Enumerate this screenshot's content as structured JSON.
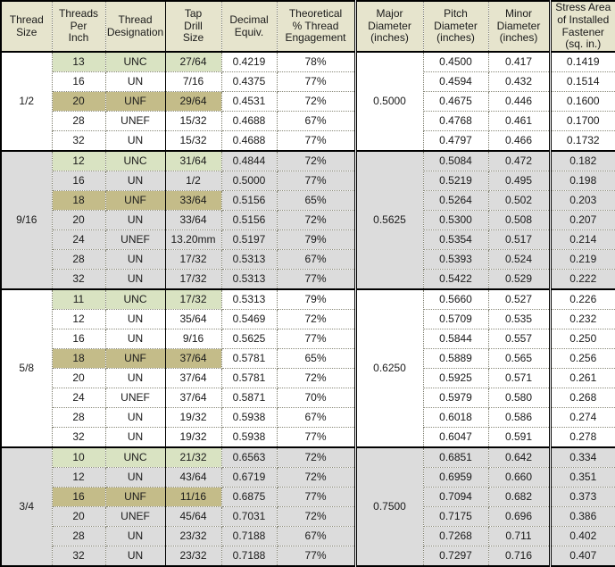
{
  "table": {
    "columns": [
      {
        "id": "thread_size",
        "lines": [
          "Thread",
          "Size"
        ],
        "bold": true
      },
      {
        "id": "threads_per_inch",
        "lines": [
          "Threads",
          "Per",
          "Inch"
        ],
        "bold": true
      },
      {
        "id": "thread_designation",
        "lines": [
          "Thread",
          "Designation"
        ],
        "bold": false
      },
      {
        "id": "tap_drill_size",
        "lines": [
          "Tap",
          "Drill",
          "Size"
        ],
        "bold": true
      },
      {
        "id": "decimal_equiv",
        "lines": [
          "Decimal",
          "Equiv."
        ],
        "bold": false
      },
      {
        "id": "pct_engagement",
        "lines": [
          "Theoretical",
          "% Thread",
          "Engagement"
        ],
        "bold": false
      },
      {
        "id": "major_diameter",
        "lines": [
          "Major",
          "Diameter",
          "(inches)"
        ],
        "bold": false
      },
      {
        "id": "pitch_diameter",
        "lines": [
          "Pitch",
          "Diameter",
          "(inches)"
        ],
        "bold": false
      },
      {
        "id": "minor_diameter",
        "lines": [
          "Minor",
          "Diameter",
          "(inches)"
        ],
        "bold": false
      },
      {
        "id": "stress_area",
        "lines": [
          "Stress Area",
          "of Installed",
          "Fastener",
          "(sq. in.)"
        ],
        "bold": false
      }
    ],
    "groups": [
      {
        "thread_size": "1/2",
        "major_diameter": "0.5000",
        "shaded": false,
        "rows": [
          {
            "tpi": "13",
            "designation": "UNC",
            "tap_drill": "27/64",
            "decimal": "0.4219",
            "engagement": "78%",
            "pitch": "0.4500",
            "minor": "0.417",
            "stress": "0.1419",
            "highlight": "unc"
          },
          {
            "tpi": "16",
            "designation": "UN",
            "tap_drill": "7/16",
            "decimal": "0.4375",
            "engagement": "77%",
            "pitch": "0.4594",
            "minor": "0.432",
            "stress": "0.1514",
            "highlight": ""
          },
          {
            "tpi": "20",
            "designation": "UNF",
            "tap_drill": "29/64",
            "decimal": "0.4531",
            "engagement": "72%",
            "pitch": "0.4675",
            "minor": "0.446",
            "stress": "0.1600",
            "highlight": "unf"
          },
          {
            "tpi": "28",
            "designation": "UNEF",
            "tap_drill": "15/32",
            "decimal": "0.4688",
            "engagement": "67%",
            "pitch": "0.4768",
            "minor": "0.461",
            "stress": "0.1700",
            "highlight": ""
          },
          {
            "tpi": "32",
            "designation": "UN",
            "tap_drill": "15/32",
            "decimal": "0.4688",
            "engagement": "77%",
            "pitch": "0.4797",
            "minor": "0.466",
            "stress": "0.1732",
            "highlight": ""
          }
        ]
      },
      {
        "thread_size": "9/16",
        "major_diameter": "0.5625",
        "shaded": true,
        "rows": [
          {
            "tpi": "12",
            "designation": "UNC",
            "tap_drill": "31/64",
            "decimal": "0.4844",
            "engagement": "72%",
            "pitch": "0.5084",
            "minor": "0.472",
            "stress": "0.182",
            "highlight": "unc"
          },
          {
            "tpi": "16",
            "designation": "UN",
            "tap_drill": "1/2",
            "decimal": "0.5000",
            "engagement": "77%",
            "pitch": "0.5219",
            "minor": "0.495",
            "stress": "0.198",
            "highlight": ""
          },
          {
            "tpi": "18",
            "designation": "UNF",
            "tap_drill": "33/64",
            "decimal": "0.5156",
            "engagement": "65%",
            "pitch": "0.5264",
            "minor": "0.502",
            "stress": "0.203",
            "highlight": "unf"
          },
          {
            "tpi": "20",
            "designation": "UN",
            "tap_drill": "33/64",
            "decimal": "0.5156",
            "engagement": "72%",
            "pitch": "0.5300",
            "minor": "0.508",
            "stress": "0.207",
            "highlight": ""
          },
          {
            "tpi": "24",
            "designation": "UNEF",
            "tap_drill": "13.20mm",
            "decimal": "0.5197",
            "engagement": "79%",
            "pitch": "0.5354",
            "minor": "0.517",
            "stress": "0.214",
            "highlight": ""
          },
          {
            "tpi": "28",
            "designation": "UN",
            "tap_drill": "17/32",
            "decimal": "0.5313",
            "engagement": "67%",
            "pitch": "0.5393",
            "minor": "0.524",
            "stress": "0.219",
            "highlight": ""
          },
          {
            "tpi": "32",
            "designation": "UN",
            "tap_drill": "17/32",
            "decimal": "0.5313",
            "engagement": "77%",
            "pitch": "0.5422",
            "minor": "0.529",
            "stress": "0.222",
            "highlight": ""
          }
        ]
      },
      {
        "thread_size": "5/8",
        "major_diameter": "0.6250",
        "shaded": false,
        "rows": [
          {
            "tpi": "11",
            "designation": "UNC",
            "tap_drill": "17/32",
            "decimal": "0.5313",
            "engagement": "79%",
            "pitch": "0.5660",
            "minor": "0.527",
            "stress": "0.226",
            "highlight": "unc"
          },
          {
            "tpi": "12",
            "designation": "UN",
            "tap_drill": "35/64",
            "decimal": "0.5469",
            "engagement": "72%",
            "pitch": "0.5709",
            "minor": "0.535",
            "stress": "0.232",
            "highlight": ""
          },
          {
            "tpi": "16",
            "designation": "UN",
            "tap_drill": "9/16",
            "decimal": "0.5625",
            "engagement": "77%",
            "pitch": "0.5844",
            "minor": "0.557",
            "stress": "0.250",
            "highlight": ""
          },
          {
            "tpi": "18",
            "designation": "UNF",
            "tap_drill": "37/64",
            "decimal": "0.5781",
            "engagement": "65%",
            "pitch": "0.5889",
            "minor": "0.565",
            "stress": "0.256",
            "highlight": "unf"
          },
          {
            "tpi": "20",
            "designation": "UN",
            "tap_drill": "37/64",
            "decimal": "0.5781",
            "engagement": "72%",
            "pitch": "0.5925",
            "minor": "0.571",
            "stress": "0.261",
            "highlight": ""
          },
          {
            "tpi": "24",
            "designation": "UNEF",
            "tap_drill": "37/64",
            "decimal": "0.5871",
            "engagement": "70%",
            "pitch": "0.5979",
            "minor": "0.580",
            "stress": "0.268",
            "highlight": ""
          },
          {
            "tpi": "28",
            "designation": "UN",
            "tap_drill": "19/32",
            "decimal": "0.5938",
            "engagement": "67%",
            "pitch": "0.6018",
            "minor": "0.586",
            "stress": "0.274",
            "highlight": ""
          },
          {
            "tpi": "32",
            "designation": "UN",
            "tap_drill": "19/32",
            "decimal": "0.5938",
            "engagement": "77%",
            "pitch": "0.6047",
            "minor": "0.591",
            "stress": "0.278",
            "highlight": ""
          }
        ]
      },
      {
        "thread_size": "3/4",
        "major_diameter": "0.7500",
        "shaded": true,
        "rows": [
          {
            "tpi": "10",
            "designation": "UNC",
            "tap_drill": "21/32",
            "decimal": "0.6563",
            "engagement": "72%",
            "pitch": "0.6851",
            "minor": "0.642",
            "stress": "0.334",
            "highlight": "unc"
          },
          {
            "tpi": "12",
            "designation": "UN",
            "tap_drill": "43/64",
            "decimal": "0.6719",
            "engagement": "72%",
            "pitch": "0.6959",
            "minor": "0.660",
            "stress": "0.351",
            "highlight": ""
          },
          {
            "tpi": "16",
            "designation": "UNF",
            "tap_drill": "11/16",
            "decimal": "0.6875",
            "engagement": "77%",
            "pitch": "0.7094",
            "minor": "0.682",
            "stress": "0.373",
            "highlight": "unf"
          },
          {
            "tpi": "20",
            "designation": "UNEF",
            "tap_drill": "45/64",
            "decimal": "0.7031",
            "engagement": "72%",
            "pitch": "0.7175",
            "minor": "0.696",
            "stress": "0.386",
            "highlight": ""
          },
          {
            "tpi": "28",
            "designation": "UN",
            "tap_drill": "23/32",
            "decimal": "0.7188",
            "engagement": "67%",
            "pitch": "0.7268",
            "minor": "0.711",
            "stress": "0.402",
            "highlight": ""
          },
          {
            "tpi": "32",
            "designation": "UN",
            "tap_drill": "23/32",
            "decimal": "0.7188",
            "engagement": "77%",
            "pitch": "0.7297",
            "minor": "0.716",
            "stress": "0.407",
            "highlight": ""
          }
        ]
      }
    ],
    "colors": {
      "header_bg": "#e6e4cd",
      "unc_row_bg": "#d9e3c2",
      "unf_row_bg": "#c4bc89",
      "alt_group_bg": "#dcdcdc",
      "text": "#1a1a1a",
      "border": "#000000"
    }
  }
}
